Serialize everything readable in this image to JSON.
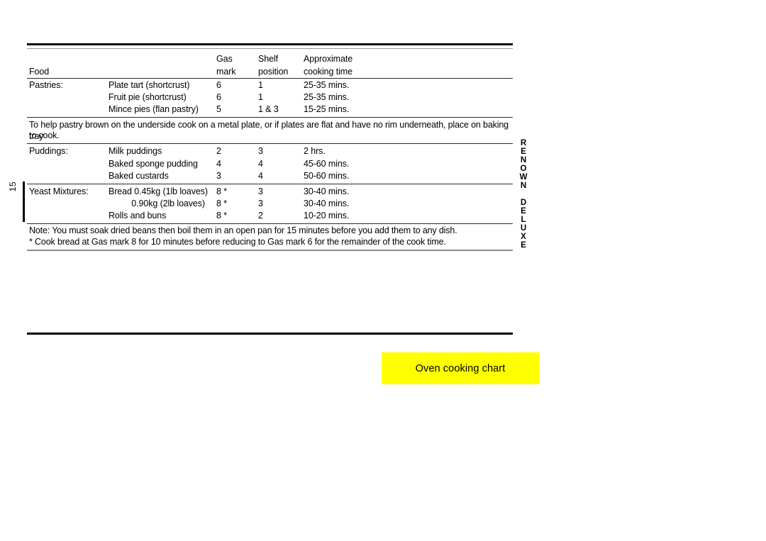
{
  "document": {
    "page_number": "15",
    "side_title": "RENOWN DELUXE",
    "banner_label": "Oven cooking chart"
  },
  "table": {
    "headers": {
      "food": "Food",
      "gas_line1": "Gas",
      "gas_line2": "mark",
      "shelf_line1": "Shelf",
      "shelf_line2": "position",
      "time_line1": "Approximate",
      "time_line2": "cooking time"
    },
    "sections": [
      {
        "label": "Pastries:",
        "rows": [
          {
            "item": "Plate tart (shortcrust)",
            "gas": "6",
            "shelf": "1",
            "time": "25-35 mins.",
            "align": "left"
          },
          {
            "item": "Fruit pie (shortcrust)",
            "gas": "6",
            "shelf": "1",
            "time": "25-35 mins.",
            "align": "left"
          },
          {
            "item": "Mince pies (flan pastry)",
            "gas": "5",
            "shelf": "1 & 3",
            "time": "15-25 mins.",
            "align": "left"
          }
        ]
      },
      {
        "label": "Puddings:",
        "rows": [
          {
            "item": "Milk puddings",
            "gas": "2",
            "shelf": "3",
            "time": "2 hrs.",
            "align": "left"
          },
          {
            "item": "Baked sponge pudding",
            "gas": "4",
            "shelf": "4",
            "time": "45-60 mins.",
            "align": "left"
          },
          {
            "item": "Baked custards",
            "gas": "3",
            "shelf": "4",
            "time": "50-60 mins.",
            "align": "left"
          }
        ]
      },
      {
        "label": "Yeast  Mixtures:",
        "rows": [
          {
            "item": "Bread 0.45kg (1lb loaves)",
            "gas": "8 *",
            "shelf": "3",
            "time": "30-40 mins.",
            "align": "left"
          },
          {
            "item": "0.90kg (2lb loaves)",
            "gas": "8 *",
            "shelf": "3",
            "time": "30-40 mins.",
            "align": "right"
          },
          {
            "item": "Rolls and buns",
            "gas": "8 *",
            "shelf": "2",
            "time": "10-20 mins.",
            "align": "left"
          }
        ]
      }
    ]
  },
  "notes": {
    "pastry_note_line1": "To help pastry brown on the underside cook on a metal plate, or if plates  are flat and have no rim underneath, place on baking tray",
    "pastry_note_line2": "to cook.",
    "beans_note": "Note: You must soak dried  beans then boil them in an open pan for 15 minutes before you add them to any dish.",
    "bread_note": "* Cook bread at Gas mark 8 for 10 minutes before reducing to Gas mark 6 for the remainder of the cook time."
  }
}
